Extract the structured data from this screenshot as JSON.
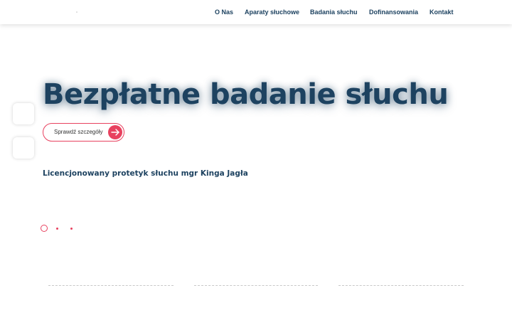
{
  "header": {
    "nav": [
      {
        "label": "O Nas"
      },
      {
        "label": "Aparaty słuchowe"
      },
      {
        "label": "Badania słuchu"
      },
      {
        "label": "Dofinansowania"
      },
      {
        "label": "Kontakt"
      }
    ]
  },
  "hero": {
    "title": "Bezpłatne badanie słuchu",
    "cta_label": "Sprawdź szczegóły",
    "subtitle": "Licencjonowany protetyk słuchu mgr Kinga Jagła"
  },
  "slider": {
    "slide_count": 3,
    "active_index": 0
  },
  "colors": {
    "primary": "#1d4260",
    "accent": "#e8415f",
    "background": "#ffffff"
  },
  "icons": {
    "cta": "arrow-right-icon"
  }
}
